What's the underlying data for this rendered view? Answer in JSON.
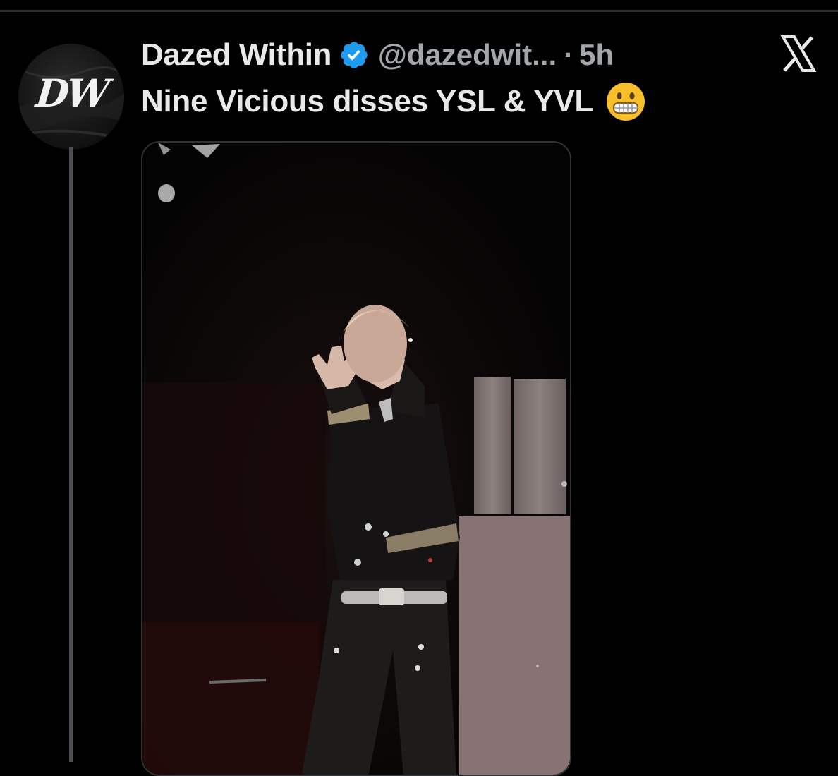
{
  "tweet": {
    "display_name": "Dazed Within",
    "verified": true,
    "handle": "@dazedwit...",
    "separator": "·",
    "time": "5h",
    "text": "Nine Vicious disses YSL & YVL",
    "emoji": "grimacing-face",
    "avatar_monogram": "DW"
  },
  "icons": {
    "verified": "verified-badge-icon",
    "close": "x-close-icon"
  },
  "colors": {
    "background": "#000000",
    "primary_text": "#e7e9ea",
    "secondary_text": "#a3a7ac",
    "verified_blue": "#1d9bf0",
    "divider": "#2f3336"
  }
}
